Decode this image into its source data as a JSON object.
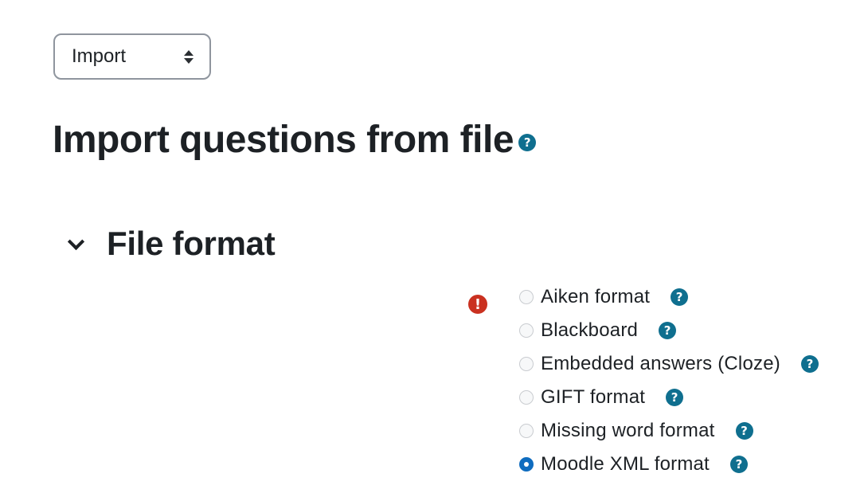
{
  "action_select": {
    "value": "Import"
  },
  "page": {
    "title": "Import questions from file",
    "help_icon": "question-circle-icon"
  },
  "section": {
    "title": "File format",
    "toggle_icon": "chevron-down-icon",
    "error_icon": "exclamation-circle-icon"
  },
  "formats": [
    {
      "label": "Aiken format",
      "checked": false
    },
    {
      "label": "Blackboard",
      "checked": false
    },
    {
      "label": "Embedded answers (Cloze)",
      "checked": false
    },
    {
      "label": "GIFT format",
      "checked": false
    },
    {
      "label": "Missing word format",
      "checked": false
    },
    {
      "label": "Moodle XML format",
      "checked": true
    }
  ],
  "colors": {
    "help": "#0f6f8f",
    "error": "#ca3120",
    "radio_selected": "#0f6cbf",
    "text": "#1d2125"
  }
}
